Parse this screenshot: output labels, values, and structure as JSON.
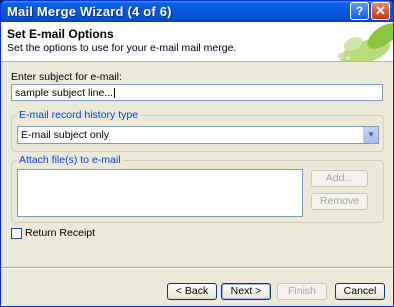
{
  "window": {
    "title": "Mail Merge Wizard (4 of 6)",
    "help_glyph": "?",
    "close_glyph": "✕"
  },
  "header": {
    "title": "Set E-mail Options",
    "subtitle": "Set the options to use for your e-mail mail merge."
  },
  "subject": {
    "label": "Enter subject for e-mail:",
    "value": "sample subject line..."
  },
  "history": {
    "group_label": "E-mail record history type",
    "selected": "E-mail subject only",
    "arrow_glyph": "▼"
  },
  "attach": {
    "group_label": "Attach file(s) to e-mail",
    "add_label": "Add...",
    "remove_label": "Remove"
  },
  "return_receipt": {
    "label": "Return Receipt",
    "checked": false
  },
  "footer": {
    "back_label": "< Back",
    "next_label": "Next >",
    "finish_label": "Finish",
    "cancel_label": "Cancel"
  },
  "colors": {
    "title_bar": "#0a5fe8",
    "group_title": "#0046d5",
    "face": "#ece9d8"
  }
}
